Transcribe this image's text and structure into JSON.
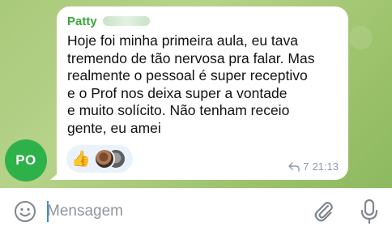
{
  "chat": {
    "avatar_initials": "PO",
    "message": {
      "sender": "Patty",
      "text": "Hoje foi minha primeira aula, eu tava\ntremendo de tão nervosa pra falar. Mas\nrealmente o pessoal é super receptivo\ne o Prof nos deixa super a vontade\ne muito solícito. Não tenham receio\ngente, eu amei",
      "reaction_emoji": "👍",
      "reply_count": "7",
      "time": "21:13"
    }
  },
  "composer": {
    "placeholder": "Mensagem"
  },
  "icons": {
    "emoji": "smiley-icon",
    "attach": "paperclip-icon",
    "mic": "microphone-icon",
    "reply": "reply-arrow-icon"
  },
  "colors": {
    "sender_name": "#3aa83a",
    "avatar_bg": "#2fb14a",
    "caret": "#3a8ed8"
  }
}
